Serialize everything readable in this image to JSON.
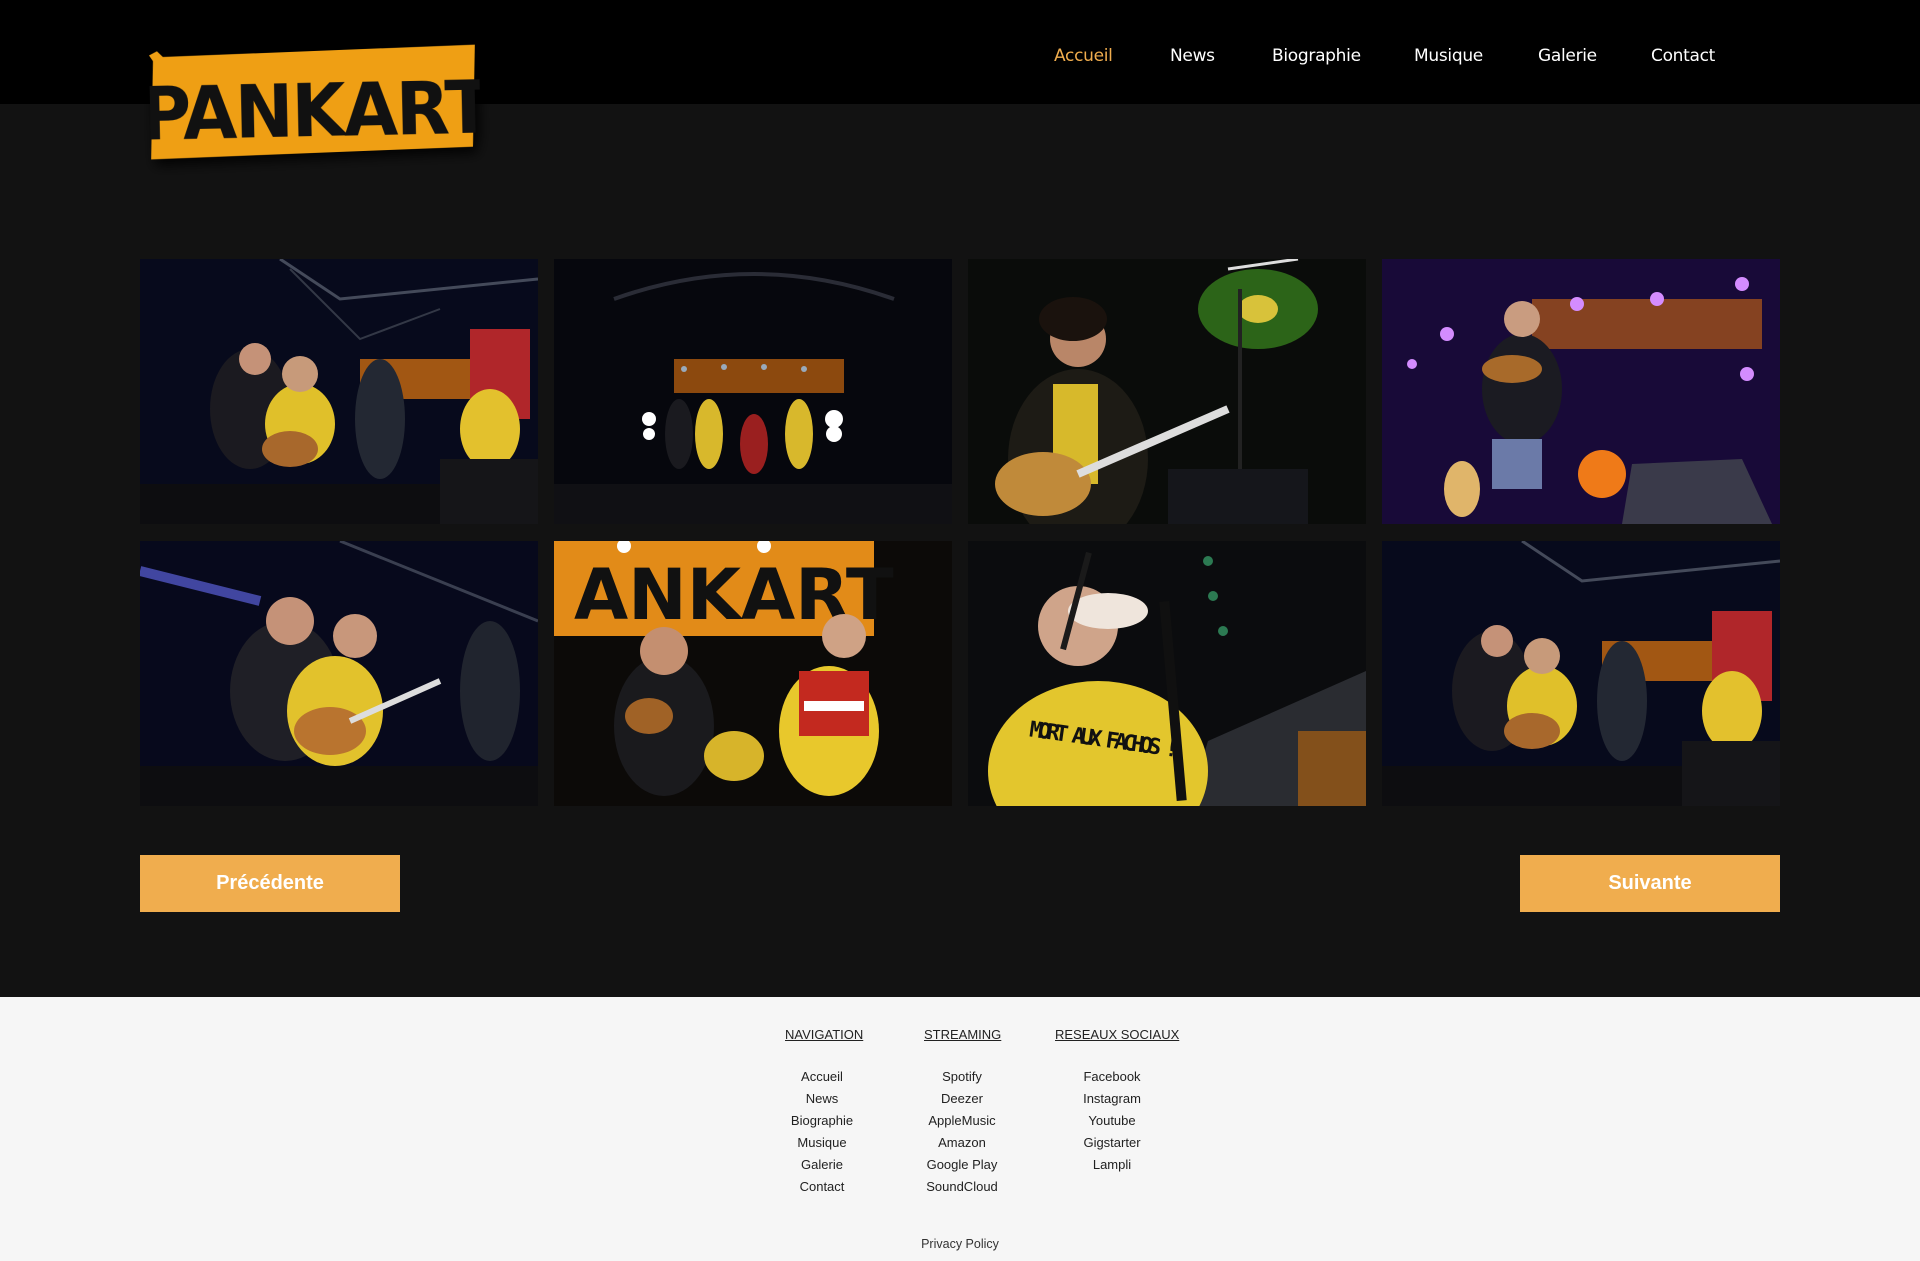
{
  "brand": {
    "logo_text": "PANKART",
    "accent_color": "#f0ad4e",
    "logo_color": "#ef9f14"
  },
  "nav": {
    "items": [
      {
        "label": "Accueil",
        "active": true
      },
      {
        "label": "News",
        "active": false
      },
      {
        "label": "Biographie",
        "active": false
      },
      {
        "label": "Musique",
        "active": false
      },
      {
        "label": "Galerie",
        "active": false
      },
      {
        "label": "Contact",
        "active": false
      }
    ]
  },
  "gallery": {
    "photos": [
      {
        "subject": "band on stage with guitars and accordion"
      },
      {
        "subject": "wide stage shot with spotlights"
      },
      {
        "subject": "guitarist singing at microphone, green light"
      },
      {
        "subject": "mandolin player under purple lights"
      },
      {
        "subject": "guitarists close-up on stage"
      },
      {
        "subject": "mandolin and accordion players under Pankart banner"
      },
      {
        "subject": "harmonica player in yellow t-shirt",
        "shirt_text": "MORT AUX FACHOS !"
      },
      {
        "subject": "band on stage with guitars and accordion (alt)"
      }
    ]
  },
  "pagination": {
    "prev_label": "Précédente",
    "next_label": "Suivante"
  },
  "footer": {
    "navigation": {
      "heading": "NAVIGATION",
      "items": [
        "Accueil",
        "News",
        "Biographie",
        "Musique",
        "Galerie",
        "Contact"
      ]
    },
    "streaming": {
      "heading": "STREAMING",
      "items": [
        "Spotify",
        "Deezer",
        "AppleMusic",
        "Amazon",
        "Google Play",
        "SoundCloud"
      ]
    },
    "social": {
      "heading": "RESEAUX SOCIAUX",
      "items": [
        "Facebook",
        "Instagram",
        "Youtube",
        "Gigstarter",
        "Lampli"
      ]
    },
    "privacy_label": "Privacy Policy"
  }
}
